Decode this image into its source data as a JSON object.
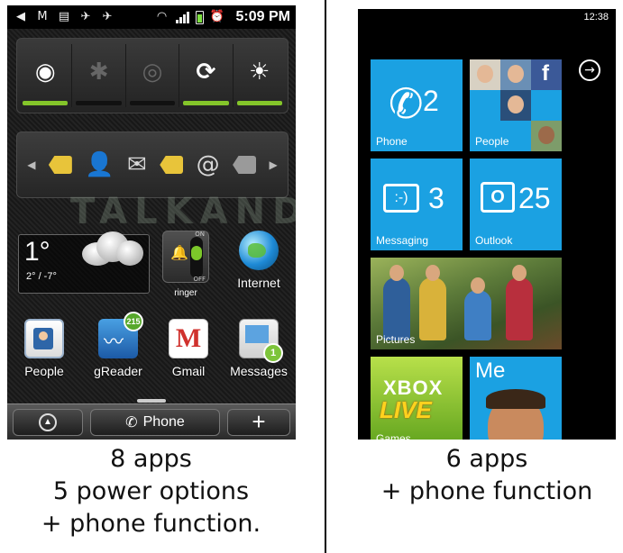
{
  "android": {
    "status_bar": {
      "time": "5:09 PM",
      "icons": [
        "back-icon",
        "gmail-icon",
        "message-icon",
        "bird-icon",
        "bird-icon",
        "wifi-icon",
        "signal-icon",
        "battery-icon",
        "alarm-icon"
      ]
    },
    "power_widget": {
      "items": [
        {
          "name": "wifi",
          "glyph": "◉",
          "state": "on"
        },
        {
          "name": "bluetooth",
          "glyph": "✱",
          "state": "off"
        },
        {
          "name": "gps",
          "glyph": "◎",
          "state": "off"
        },
        {
          "name": "sync",
          "glyph": "⟳",
          "state": "on"
        },
        {
          "name": "brightness",
          "glyph": "☀",
          "state": "on"
        }
      ]
    },
    "favorites_widget": {
      "items": [
        "tag",
        "person",
        "mail",
        "tag",
        "at",
        "tag-grey"
      ],
      "at_glyph": "@",
      "mail_glyph": "✉",
      "person_glyph": "👤"
    },
    "watermark": "TALKANDROID.COM",
    "weather": {
      "temp": "1°",
      "range": "2° / -7°"
    },
    "ringer": {
      "label": "ringer",
      "on": "ON",
      "off": "OFF"
    },
    "apps_row1": [
      {
        "label": "Internet"
      }
    ],
    "apps_row2": [
      {
        "label": "People"
      },
      {
        "label": "gReader",
        "badge": "215"
      },
      {
        "label": "Gmail"
      },
      {
        "label": "Messages",
        "badge": "1"
      }
    ],
    "dock": {
      "phone_label": "Phone",
      "plus": "+",
      "up": "▲"
    }
  },
  "captions": {
    "left": [
      "8 apps",
      "5 power options",
      "+ phone function."
    ],
    "right": [
      "6 apps",
      "+ phone function"
    ]
  },
  "wp": {
    "time": "12:38",
    "arrow": "→",
    "tiles": {
      "phone": {
        "label": "Phone",
        "count": "2",
        "glyph": "✆"
      },
      "people": {
        "label": "People",
        "fb": "f"
      },
      "messaging": {
        "label": "Messaging",
        "count": "3",
        "glyph": ":-)"
      },
      "outlook": {
        "label": "Outlook",
        "count": "25",
        "glyph": "O"
      },
      "pictures": {
        "label": "Pictures"
      },
      "xbox": {
        "label": "Games",
        "line1": "XBOX",
        "line2": "LIVE"
      },
      "me": {
        "label": "Me"
      }
    }
  },
  "colors": {
    "wp_accent": "#1ba1e2",
    "android_on": "#84c52a"
  }
}
